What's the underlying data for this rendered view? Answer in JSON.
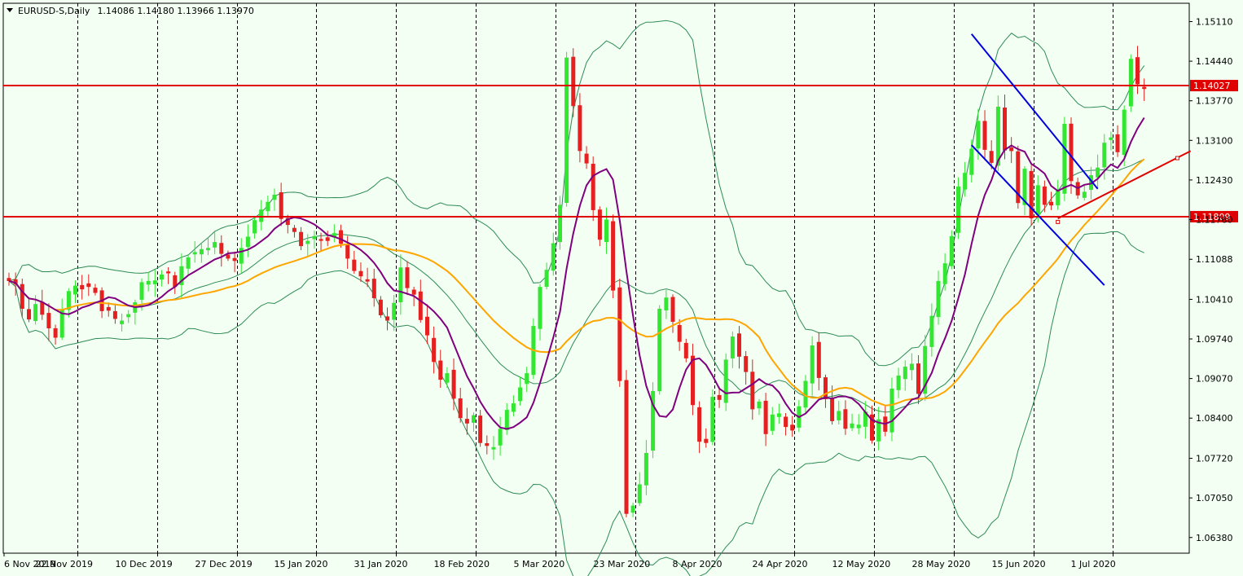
{
  "header": {
    "symbol": "EURUSD-S,Daily",
    "ohlc": "1.14086 1.14180 1.13966 1.13970"
  },
  "colors": {
    "background": "#f2fff2",
    "bull": "#32e632",
    "bear": "#e62020",
    "bollinger": "#2e8b57",
    "ma_fast": "#800080",
    "ma_slow": "#ffa500",
    "horizontal_lines": "#e00000",
    "channel_lines": "#0000e0",
    "trend_line": "#e00000"
  },
  "chart_data": {
    "type": "candlestick",
    "symbol": "EURUSD-S",
    "timeframe": "Daily",
    "y_axis": {
      "range": [
        1.0615,
        1.1555
      ],
      "ticks": [
        "1.15110",
        "1.14440",
        "1.13770",
        "1.13100",
        "1.12430",
        "1.11760",
        "1.11088",
        "1.10410",
        "1.09740",
        "1.09070",
        "1.08400",
        "1.07720",
        "1.07050",
        "1.06380"
      ],
      "tick_values": [
        1.1511,
        1.1444,
        1.1377,
        1.131,
        1.1243,
        1.1176,
        1.11088,
        1.1041,
        1.0974,
        1.0907,
        1.084,
        1.0772,
        1.0705,
        1.0638
      ]
    },
    "x_axis": {
      "labels": [
        "6 Nov 2019",
        "22 Nov 2019",
        "10 Dec 2019",
        "27 Dec 2019",
        "15 Jan 2020",
        "31 Jan 2020",
        "18 Feb 2020",
        "5 Mar 2020",
        "23 Mar 2020",
        "8 Apr 2020",
        "24 Apr 2020",
        "12 May 2020",
        "28 May 2020",
        "15 Jun 2020",
        "1 Jul 2020"
      ],
      "label_bar_index": [
        0,
        12,
        24,
        36,
        48,
        60,
        72,
        84,
        96,
        108,
        120,
        132,
        144,
        156,
        168
      ],
      "grid": "vertical dashed at period separators"
    },
    "horizontal_lines": [
      {
        "price": 1.14027,
        "label": "1.14027"
      },
      {
        "price": 1.11809,
        "label": "1.11809"
      }
    ],
    "candles_close": [
      1.1072,
      1.1066,
      1.1025,
      1.1007,
      1.1033,
      1.1015,
      1.0992,
      1.0976,
      1.1023,
      1.1055,
      1.1064,
      1.1058,
      1.1062,
      1.1052,
      1.1021,
      1.1022,
      1.1008,
      1.1005,
      1.1016,
      1.1036,
      1.107,
      1.1072,
      1.1073,
      1.1083,
      1.1085,
      1.1062,
      1.1097,
      1.1112,
      1.1121,
      1.1126,
      1.1128,
      1.1138,
      1.1118,
      1.111,
      1.1106,
      1.1128,
      1.1147,
      1.1175,
      1.1193,
      1.1206,
      1.1218,
      1.1177,
      1.1167,
      1.1155,
      1.1131,
      1.114,
      1.1148,
      1.114,
      1.114,
      1.1153,
      1.1135,
      1.111,
      1.1089,
      1.108,
      1.1071,
      1.1043,
      1.1014,
      1.1005,
      1.1035,
      1.1095,
      1.106,
      1.1049,
      1.1006,
      1.098,
      1.0935,
      1.0905,
      1.0916,
      1.0873,
      1.084,
      1.0831,
      1.0845,
      1.0798,
      1.0793,
      1.0791,
      1.0822,
      1.0854,
      1.0865,
      1.0892,
      1.0916,
      1.0996,
      1.1062,
      1.1091,
      1.1136,
      1.1201,
      1.145,
      1.1368,
      1.1292,
      1.1271,
      1.1192,
      1.1142,
      1.1176,
      1.1056,
      1.0903,
      1.0678,
      1.0692,
      1.0728,
      1.0781,
      1.0886,
      1.1025,
      1.1044,
      1.1003,
      1.0969,
      1.0941,
      1.0862,
      1.08,
      1.0798,
      1.0876,
      1.0871,
      1.0939,
      1.0978,
      1.0944,
      1.0918,
      1.0855,
      1.0868,
      1.0813,
      1.0846,
      1.0848,
      1.0825,
      1.0819,
      1.086,
      1.0903,
      1.0963,
      1.0908,
      1.0872,
      1.0835,
      1.0852,
      1.0822,
      1.0831,
      1.0829,
      1.0851,
      1.0802,
      1.0838,
      1.0817,
      1.089,
      1.0912,
      1.0927,
      1.0932,
      1.0881,
      1.0962,
      1.1013,
      1.1072,
      1.1102,
      1.1148,
      1.1232,
      1.1255,
      1.1296,
      1.1343,
      1.1294,
      1.1272,
      1.1367,
      1.1293,
      1.1292,
      1.1204,
      1.1262,
      1.1178,
      1.1234,
      1.1201,
      1.12,
      1.1225,
      1.1338,
      1.1241,
      1.1217,
      1.1223,
      1.1251,
      1.1264,
      1.1306,
      1.1315,
      1.129,
      1.1362,
      1.1448,
      1.1405,
      1.1397
    ],
    "moving_averages": [
      {
        "name": "fast MA",
        "color": "purple"
      },
      {
        "name": "slow MA",
        "color": "orange"
      }
    ],
    "indicators": [
      "Bollinger Bands"
    ],
    "annotations": [
      "descending channel (blue lines)",
      "ascending trend line (red)"
    ],
    "grid": true,
    "legend": "none"
  }
}
